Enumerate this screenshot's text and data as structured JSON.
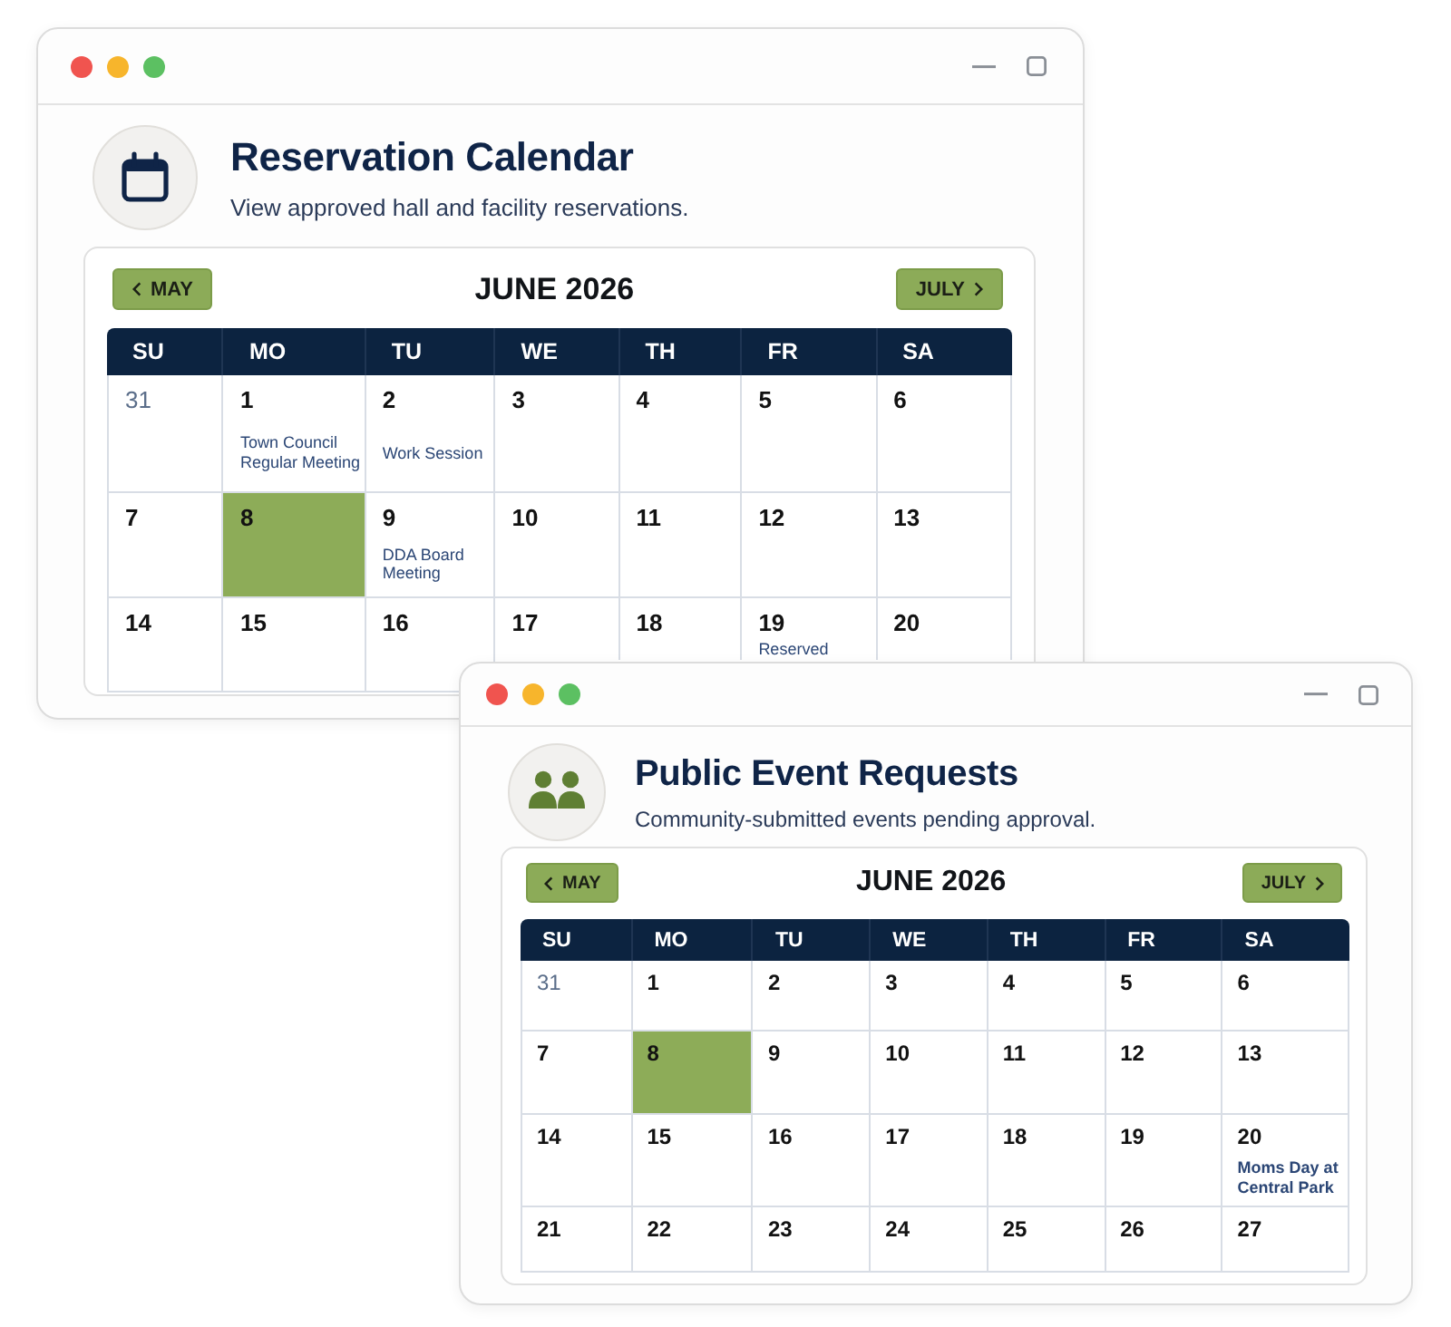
{
  "windows": [
    {
      "kind": "reservations",
      "title": "Reservation Calendar",
      "subtitle": "View approved hall and facility reservations.",
      "calendar": {
        "prev": "MAY",
        "month": "JUNE 2026",
        "next": "JULY",
        "weekdays": [
          "SU",
          "MO",
          "TU",
          "WE",
          "TH",
          "FR",
          "SA"
        ],
        "weeks": [
          [
            {
              "day": "31",
              "outside_month": true,
              "selected": false
            },
            {
              "day": "1",
              "outside_month": false,
              "selected": false,
              "event": "Town Council Regular Meeting"
            },
            {
              "day": "2",
              "outside_month": false,
              "selected": false,
              "event": "Work Session"
            },
            {
              "day": "3",
              "outside_month": false,
              "selected": false
            },
            {
              "day": "4",
              "outside_month": false,
              "selected": false
            },
            {
              "day": "5",
              "outside_month": false,
              "selected": false
            },
            {
              "day": "6",
              "outside_month": false,
              "selected": false
            }
          ],
          [
            {
              "day": "7",
              "outside_month": false,
              "selected": false
            },
            {
              "day": "8",
              "outside_month": false,
              "selected": true
            },
            {
              "day": "9",
              "outside_month": false,
              "selected": false,
              "event": "DDA Board Meeting"
            },
            {
              "day": "10",
              "outside_month": false,
              "selected": false
            },
            {
              "day": "11",
              "outside_month": false,
              "selected": false
            },
            {
              "day": "12",
              "outside_month": false,
              "selected": false
            },
            {
              "day": "13",
              "outside_month": false,
              "selected": false
            }
          ],
          [
            {
              "day": "14",
              "outside_month": false,
              "selected": false
            },
            {
              "day": "15",
              "outside_month": false,
              "selected": false
            },
            {
              "day": "16",
              "outside_month": false,
              "selected": false
            },
            {
              "day": "17",
              "outside_month": false,
              "selected": false
            },
            {
              "day": "18",
              "outside_month": false,
              "selected": false
            },
            {
              "day": "19",
              "outside_month": false,
              "selected": false,
              "event": "Reserved"
            },
            {
              "day": "20",
              "outside_month": false,
              "selected": false
            }
          ]
        ]
      }
    },
    {
      "kind": "requests",
      "title": "Public Event Requests",
      "subtitle": "Community-submitted events pending approval.",
      "calendar": {
        "prev": "MAY",
        "month": "JUNE 2026",
        "next": "JULY",
        "weekdays": [
          "SU",
          "MO",
          "TU",
          "WE",
          "TH",
          "FR",
          "SA"
        ],
        "weeks": [
          [
            {
              "day": "31",
              "outside_month": true,
              "selected": false
            },
            {
              "day": "1",
              "outside_month": false,
              "selected": false
            },
            {
              "day": "2",
              "outside_month": false,
              "selected": false
            },
            {
              "day": "3",
              "outside_month": false,
              "selected": false
            },
            {
              "day": "4",
              "outside_month": false,
              "selected": false
            },
            {
              "day": "5",
              "outside_month": false,
              "selected": false
            },
            {
              "day": "6",
              "outside_month": false,
              "selected": false
            }
          ],
          [
            {
              "day": "7",
              "outside_month": false,
              "selected": false
            },
            {
              "day": "8",
              "outside_month": false,
              "selected": true
            },
            {
              "day": "9",
              "outside_month": false,
              "selected": false
            },
            {
              "day": "10",
              "outside_month": false,
              "selected": false
            },
            {
              "day": "11",
              "outside_month": false,
              "selected": false
            },
            {
              "day": "12",
              "outside_month": false,
              "selected": false
            },
            {
              "day": "13",
              "outside_month": false,
              "selected": false
            }
          ],
          [
            {
              "day": "14",
              "outside_month": false,
              "selected": false
            },
            {
              "day": "15",
              "outside_month": false,
              "selected": false
            },
            {
              "day": "16",
              "outside_month": false,
              "selected": false
            },
            {
              "day": "17",
              "outside_month": false,
              "selected": false
            },
            {
              "day": "18",
              "outside_month": false,
              "selected": false
            },
            {
              "day": "19",
              "outside_month": false,
              "selected": false
            },
            {
              "day": "20",
              "outside_month": false,
              "selected": false,
              "event": "Moms Day at Central Park"
            }
          ],
          [
            {
              "day": "21",
              "outside_month": false,
              "selected": false
            },
            {
              "day": "22",
              "outside_month": false,
              "selected": false
            },
            {
              "day": "23",
              "outside_month": false,
              "selected": false
            },
            {
              "day": "24",
              "outside_month": false,
              "selected": false
            },
            {
              "day": "25",
              "outside_month": false,
              "selected": false
            },
            {
              "day": "26",
              "outside_month": false,
              "selected": false
            },
            {
              "day": "27",
              "outside_month": false,
              "selected": false
            }
          ]
        ]
      }
    }
  ]
}
